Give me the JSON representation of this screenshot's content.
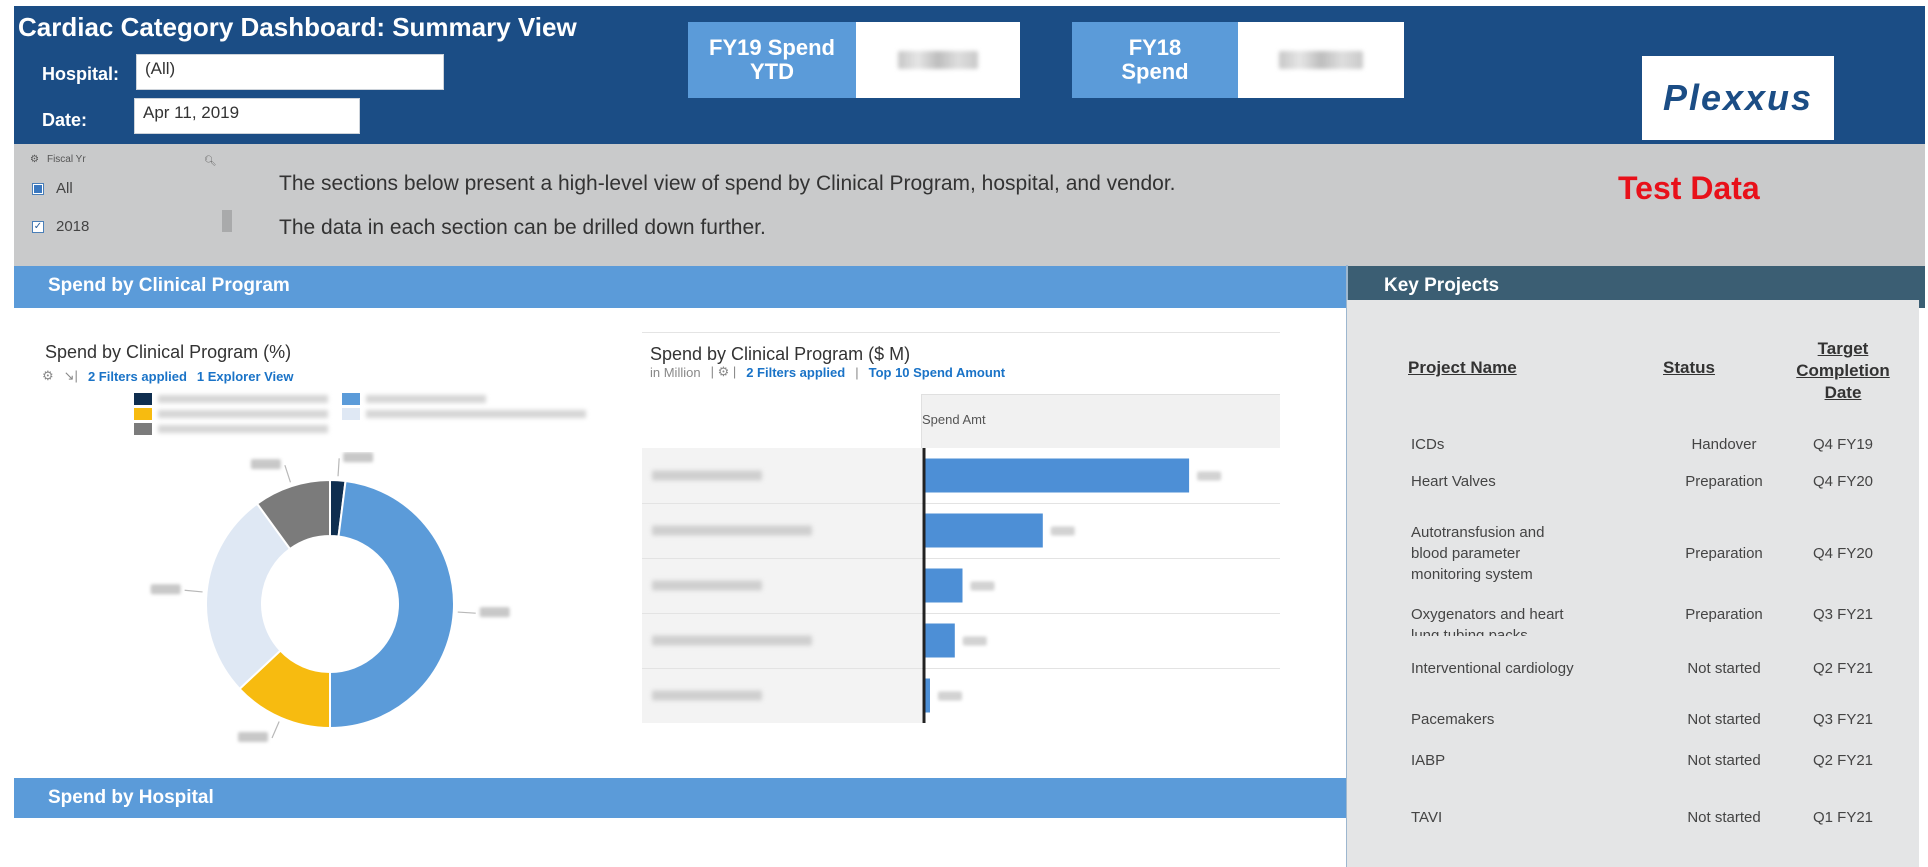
{
  "header": {
    "title": "Cardiac Category Dashboard: Summary View",
    "hospital_label": "Hospital:",
    "hospital_value": "(All)",
    "date_label": "Date:",
    "date_value": "Apr 11, 2019",
    "kpi1_label_line1": "FY19 Spend",
    "kpi1_label_line2": "YTD",
    "kpi2_label_line1": "FY18",
    "kpi2_label_line2": "Spend",
    "logo_text": "Plexxus"
  },
  "band": {
    "selector_title": "Fiscal Yr",
    "selector_items": [
      {
        "label": "All",
        "checked": false
      },
      {
        "label": "2018",
        "checked": true
      }
    ],
    "line1": "The sections below present a high-level view of spend by Clinical Program, hospital, and vendor.",
    "line2": "The data in each section can be drilled down further.",
    "test_data": "Test Data"
  },
  "sections": {
    "clinical_program": "Spend by Clinical Program",
    "key_projects": "Key Projects",
    "hospital": "Spend by Hospital"
  },
  "donut": {
    "title": "Spend by Clinical Program (%)",
    "filters": "2 Filters applied",
    "explorer": "1 Explorer View"
  },
  "bar": {
    "title": "Spend by Clinical Program ($ M)",
    "unit": "in Million",
    "filters": "2 Filters applied",
    "top10": "Top 10 Spend Amount",
    "column_header": "Spend Amt"
  },
  "chart_data": [
    {
      "type": "pie",
      "title": "Spend by Clinical Program (%)",
      "values": [
        2,
        48,
        13,
        27,
        10
      ],
      "colors": [
        "#0f2e4f",
        "#5b9bd9",
        "#f7bb10",
        "#dfe8f4",
        "#7b7b7b"
      ]
    },
    {
      "type": "bar",
      "title": "Spend by Clinical Program ($ M)",
      "values": [
        24.1,
        10.8,
        3.5,
        2.8,
        0.5
      ],
      "xlim": [
        0,
        30
      ],
      "color": "#4d8fd6"
    }
  ],
  "key_projects": {
    "headers": {
      "name": "Project Name",
      "status": "Status",
      "target_l1": "Target",
      "target_l2": "Completion",
      "target_l3": "Date"
    },
    "rows": [
      {
        "name_l1": "ICDs",
        "name_l2": "",
        "name_l3": "",
        "status": "Handover",
        "date": "Q4 FY19"
      },
      {
        "name_l1": "Heart Valves",
        "name_l2": "",
        "name_l3": "",
        "status": "Preparation",
        "date": "Q4 FY20"
      },
      {
        "name_l1": "Autotransfusion and",
        "name_l2": "blood parameter",
        "name_l3": "monitoring system",
        "status": "Preparation",
        "date": "Q4 FY20"
      },
      {
        "name_l1": "Oxygenators and heart",
        "name_l2": "lung tubing packs",
        "name_l3": "",
        "status": "Preparation",
        "date": "Q3 FY21"
      },
      {
        "name_l1": "Interventional cardiology",
        "name_l2": "",
        "name_l3": "",
        "status": "Not started",
        "date": "Q2 FY21"
      },
      {
        "name_l1": "Pacemakers",
        "name_l2": "",
        "name_l3": "",
        "status": "Not started",
        "date": "Q3 FY21"
      },
      {
        "name_l1": "IABP",
        "name_l2": "",
        "name_l3": "",
        "status": "Not started",
        "date": "Q2 FY21"
      },
      {
        "name_l1": "TAVI",
        "name_l2": "",
        "name_l3": "",
        "status": "Not started",
        "date": "Q1 FY21"
      }
    ]
  }
}
